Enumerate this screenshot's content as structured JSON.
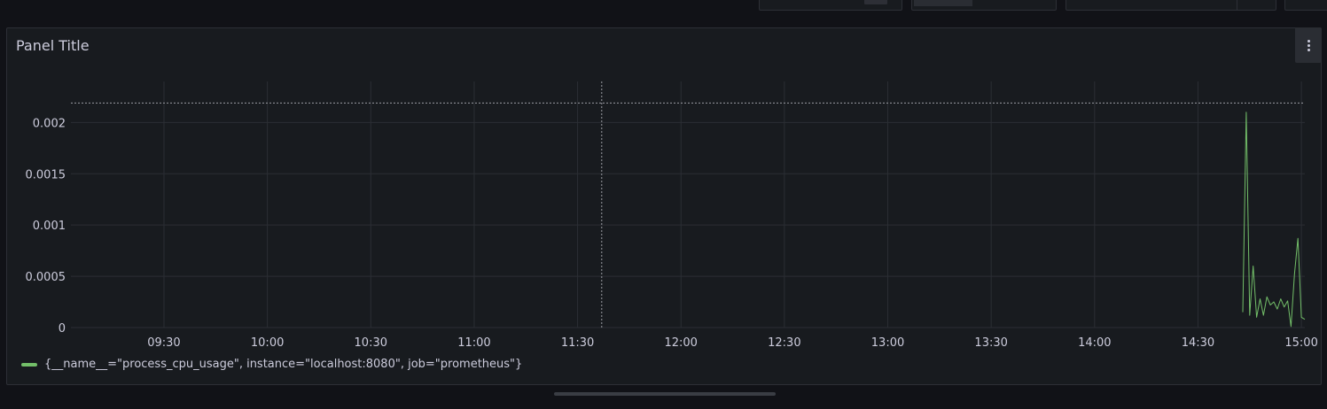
{
  "panel": {
    "title": "Panel Title",
    "menu_icon": "kebab-menu-icon"
  },
  "chart_data": {
    "type": "line",
    "title": "Panel Title",
    "xlabel": "",
    "ylabel": "",
    "x_tick_labels": [
      "09:30",
      "10:00",
      "10:30",
      "11:00",
      "11:30",
      "12:00",
      "12:30",
      "13:00",
      "13:30",
      "14:00",
      "14:30",
      "15:00"
    ],
    "y_tick_labels": [
      "0",
      "0.0005",
      "0.001",
      "0.0015",
      "0.002"
    ],
    "ylim": [
      0,
      0.0024
    ],
    "xlim": [
      "09:03",
      "15:01"
    ],
    "threshold": 0.00219,
    "cursor_time": "11:37",
    "grid": true,
    "legend_position": "bottom-left",
    "series": [
      {
        "name": "{__name__=\"process_cpu_usage\", instance=\"localhost:8080\", job=\"prometheus\"}",
        "color": "#73bf69",
        "x": [
          "14:43",
          "14:44",
          "14:45",
          "14:46",
          "14:47",
          "14:48",
          "14:49",
          "14:50",
          "14:51",
          "14:52",
          "14:53",
          "14:54",
          "14:55",
          "14:56",
          "14:57",
          "14:58",
          "14:59",
          "15:00",
          "15:01"
        ],
        "y": [
          0.00015,
          0.0021,
          0.00012,
          0.0006,
          0.0001,
          0.00028,
          0.00012,
          0.0003,
          0.00022,
          0.00025,
          0.00018,
          0.00028,
          0.0002,
          0.00026,
          1e-05,
          0.00052,
          0.00087,
          0.0001,
          8e-05
        ]
      }
    ]
  },
  "legend": {
    "label": "{__name__=\"process_cpu_usage\", instance=\"localhost:8080\", job=\"prometheus\"}"
  }
}
